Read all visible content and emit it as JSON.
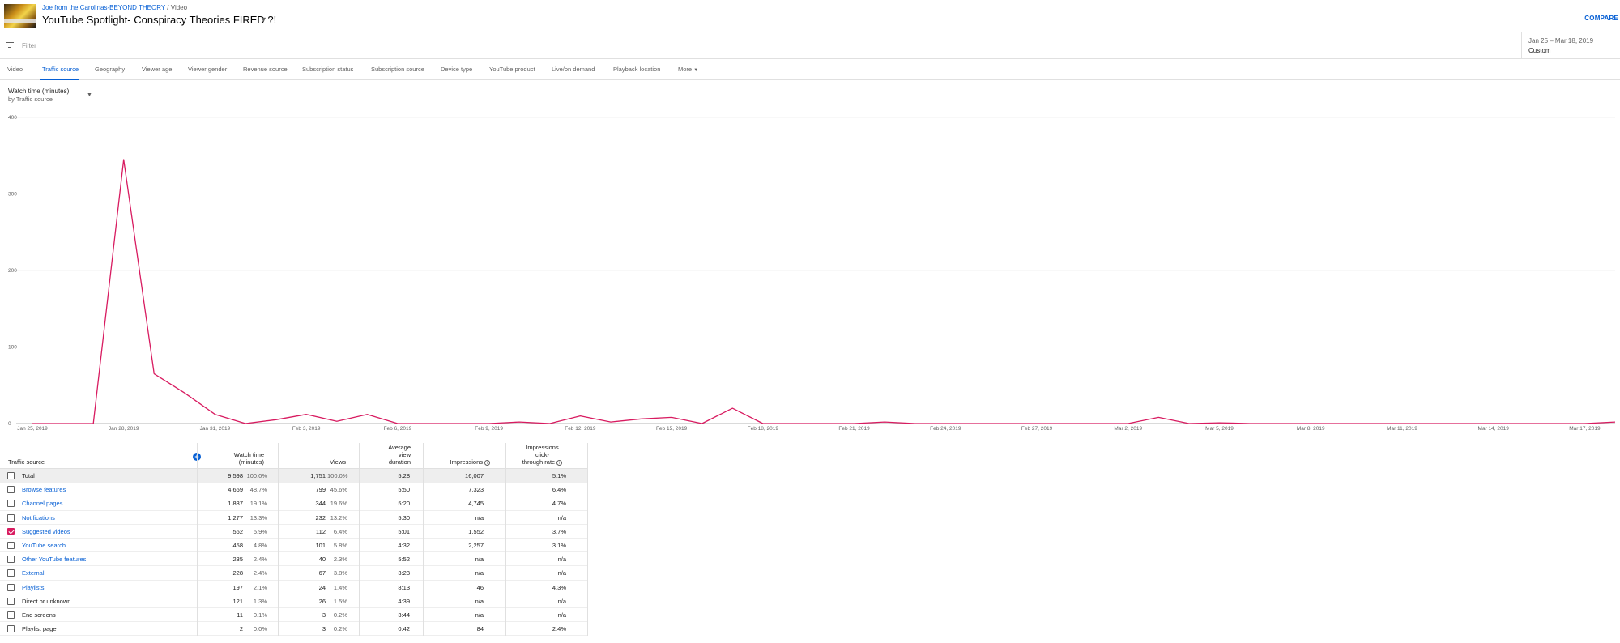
{
  "header": {
    "channel": "Joe from the Carolinas-BEYOND THEORY",
    "separator": "/",
    "section": "Video",
    "video_title": "YouTube Spotlight- Conspiracy Theories FIRED ?!",
    "compare_label": "COMPARE"
  },
  "filter": {
    "placeholder": "Filter"
  },
  "date_range": {
    "range": "Jan 25 – Mar 18, 2019",
    "preset": "Custom"
  },
  "tabs": [
    {
      "label": "Video",
      "active": false
    },
    {
      "label": "Traffic source",
      "active": true
    },
    {
      "label": "Geography",
      "active": false
    },
    {
      "label": "Viewer age",
      "active": false
    },
    {
      "label": "Viewer gender",
      "active": false
    },
    {
      "label": "Revenue source",
      "active": false
    },
    {
      "label": "Subscription status",
      "active": false
    },
    {
      "label": "Subscription source",
      "active": false
    },
    {
      "label": "Device type",
      "active": false
    },
    {
      "label": "YouTube product",
      "active": false
    },
    {
      "label": "Live/on demand",
      "active": false
    },
    {
      "label": "Playback location",
      "active": false
    },
    {
      "label": "More",
      "active": false
    }
  ],
  "metric": {
    "name": "Watch time (minutes)",
    "breakdown": "by Traffic source"
  },
  "chart_data": {
    "type": "line",
    "ylim": [
      0,
      400
    ],
    "y_ticks": [
      "0",
      "100",
      "200",
      "300",
      "400"
    ],
    "x_tick_labels": [
      "Jan 25, 2019",
      "Jan 28, 2019",
      "Jan 31, 2019",
      "Feb 3, 2019",
      "Feb 6, 2019",
      "Feb 9, 2019",
      "Feb 12, 2019",
      "Feb 15, 2019",
      "Feb 18, 2019",
      "Feb 21, 2019",
      "Feb 24, 2019",
      "Feb 27, 2019",
      "Mar 2, 2019",
      "Mar 5, 2019",
      "Mar 8, 2019",
      "Mar 11, 2019",
      "Mar 14, 2019",
      "Mar 17, 2019"
    ],
    "x": [
      "Jan 25, 2019",
      "Jan 26, 2019",
      "Jan 27, 2019",
      "Jan 28, 2019",
      "Jan 29, 2019",
      "Jan 30, 2019",
      "Jan 31, 2019",
      "Feb 1, 2019",
      "Feb 2, 2019",
      "Feb 3, 2019",
      "Feb 4, 2019",
      "Feb 5, 2019",
      "Feb 6, 2019",
      "Feb 7, 2019",
      "Feb 8, 2019",
      "Feb 9, 2019",
      "Feb 10, 2019",
      "Feb 11, 2019",
      "Feb 12, 2019",
      "Feb 13, 2019",
      "Feb 14, 2019",
      "Feb 15, 2019",
      "Feb 16, 2019",
      "Feb 17, 2019",
      "Feb 18, 2019",
      "Feb 19, 2019",
      "Feb 20, 2019",
      "Feb 21, 2019",
      "Feb 22, 2019",
      "Feb 23, 2019",
      "Feb 24, 2019",
      "Feb 25, 2019",
      "Feb 26, 2019",
      "Feb 27, 2019",
      "Feb 28, 2019",
      "Mar 1, 2019",
      "Mar 2, 2019",
      "Mar 3, 2019",
      "Mar 4, 2019",
      "Mar 5, 2019",
      "Mar 6, 2019",
      "Mar 7, 2019",
      "Mar 8, 2019",
      "Mar 9, 2019",
      "Mar 10, 2019",
      "Mar 11, 2019",
      "Mar 12, 2019",
      "Mar 13, 2019",
      "Mar 14, 2019",
      "Mar 15, 2019",
      "Mar 16, 2019",
      "Mar 17, 2019",
      "Mar 18, 2019"
    ],
    "series": [
      {
        "color": "#d81b60",
        "values": [
          0,
          0,
          0,
          345,
          65,
          40,
          12,
          0,
          5,
          12,
          3,
          12,
          0,
          0,
          0,
          0,
          2,
          0,
          10,
          2,
          6,
          8,
          0,
          20,
          0,
          0,
          0,
          0,
          2,
          0,
          0,
          0,
          0,
          0,
          0,
          0,
          0,
          8,
          0,
          1,
          0,
          0,
          0,
          0,
          0,
          0,
          0,
          0,
          0,
          0,
          0,
          0,
          2,
          0,
          0
        ]
      }
    ],
    "grid": true
  },
  "table": {
    "headers": {
      "source": "Traffic source",
      "watch_time": [
        "Watch time",
        "(minutes)"
      ],
      "views": "Views",
      "avg_duration": [
        "Average",
        "view",
        "duration"
      ],
      "impressions": "Impressions",
      "ctr": [
        "Impressions",
        "click-",
        "through rate"
      ]
    },
    "rows": [
      {
        "source": "Total",
        "link": false,
        "checked": false,
        "total": true,
        "watch": "9,598",
        "watch_pct": "100.0%",
        "views": "1,751",
        "views_pct": "100.0%",
        "avg": "5:28",
        "impressions": "16,007",
        "ctr": "5.1%"
      },
      {
        "source": "Browse features",
        "link": true,
        "checked": false,
        "watch": "4,669",
        "watch_pct": "48.7%",
        "views": "799",
        "views_pct": "45.6%",
        "avg": "5:50",
        "impressions": "7,323",
        "ctr": "6.4%"
      },
      {
        "source": "Channel pages",
        "link": true,
        "checked": false,
        "watch": "1,837",
        "watch_pct": "19.1%",
        "views": "344",
        "views_pct": "19.6%",
        "avg": "5:20",
        "impressions": "4,745",
        "ctr": "4.7%"
      },
      {
        "source": "Notifications",
        "link": true,
        "checked": false,
        "watch": "1,277",
        "watch_pct": "13.3%",
        "views": "232",
        "views_pct": "13.2%",
        "avg": "5:30",
        "impressions": "n/a",
        "ctr": "n/a"
      },
      {
        "source": "Suggested videos",
        "link": true,
        "checked": true,
        "watch": "562",
        "watch_pct": "5.9%",
        "views": "112",
        "views_pct": "6.4%",
        "avg": "5:01",
        "impressions": "1,552",
        "ctr": "3.7%"
      },
      {
        "source": "YouTube search",
        "link": true,
        "checked": false,
        "watch": "458",
        "watch_pct": "4.8%",
        "views": "101",
        "views_pct": "5.8%",
        "avg": "4:32",
        "impressions": "2,257",
        "ctr": "3.1%"
      },
      {
        "source": "Other YouTube features",
        "link": true,
        "checked": false,
        "watch": "235",
        "watch_pct": "2.4%",
        "views": "40",
        "views_pct": "2.3%",
        "avg": "5:52",
        "impressions": "n/a",
        "ctr": "n/a"
      },
      {
        "source": "External",
        "link": true,
        "checked": false,
        "watch": "228",
        "watch_pct": "2.4%",
        "views": "67",
        "views_pct": "3.8%",
        "avg": "3:23",
        "impressions": "n/a",
        "ctr": "n/a"
      },
      {
        "source": "Playlists",
        "link": true,
        "checked": false,
        "watch": "197",
        "watch_pct": "2.1%",
        "views": "24",
        "views_pct": "1.4%",
        "avg": "8:13",
        "impressions": "46",
        "ctr": "4.3%"
      },
      {
        "source": "Direct or unknown",
        "link": false,
        "checked": false,
        "watch": "121",
        "watch_pct": "1.3%",
        "views": "26",
        "views_pct": "1.5%",
        "avg": "4:39",
        "impressions": "n/a",
        "ctr": "n/a"
      },
      {
        "source": "End screens",
        "link": false,
        "checked": false,
        "watch": "11",
        "watch_pct": "0.1%",
        "views": "3",
        "views_pct": "0.2%",
        "avg": "3:44",
        "impressions": "n/a",
        "ctr": "n/a"
      },
      {
        "source": "Playlist page",
        "link": false,
        "checked": false,
        "watch": "2",
        "watch_pct": "0.0%",
        "views": "3",
        "views_pct": "0.2%",
        "avg": "0:42",
        "impressions": "84",
        "ctr": "2.4%"
      }
    ]
  },
  "icons": {
    "filter": "filter-icon",
    "caret": "caret-down-icon",
    "add": "add-metric-icon",
    "info": "info-icon"
  },
  "colors": {
    "accent": "#065fd4",
    "series": "#d81b60"
  }
}
